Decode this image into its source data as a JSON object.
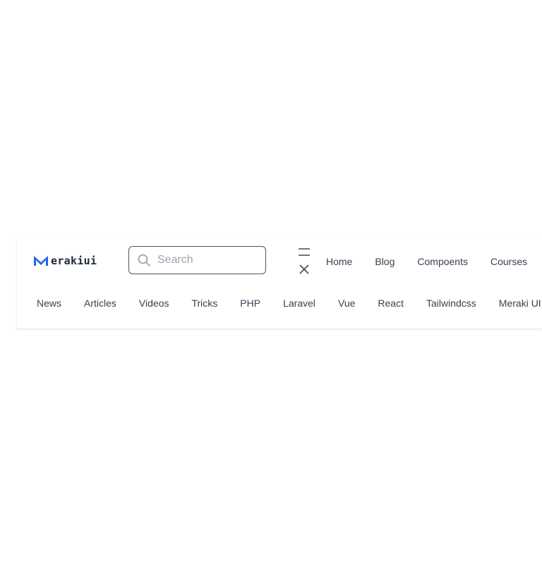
{
  "brand": {
    "name": "erakiui",
    "logo_icon": "meraki-m-logo-icon",
    "accent_color": "#2563eb"
  },
  "search": {
    "placeholder": "Search",
    "value": "",
    "icon": "search-icon"
  },
  "menu_toggle": {
    "icons": [
      "menu-lines-icon",
      "close-x-icon"
    ]
  },
  "main_nav": {
    "items": [
      {
        "label": "Home"
      },
      {
        "label": "Blog"
      },
      {
        "label": "Compoents"
      },
      {
        "label": "Courses"
      }
    ]
  },
  "category_nav": {
    "items": [
      {
        "label": "News"
      },
      {
        "label": "Articles"
      },
      {
        "label": "Videos"
      },
      {
        "label": "Tricks"
      },
      {
        "label": "PHP"
      },
      {
        "label": "Laravel"
      },
      {
        "label": "Vue"
      },
      {
        "label": "React"
      },
      {
        "label": "Tailwindcss"
      },
      {
        "label": "Meraki UI"
      }
    ]
  }
}
